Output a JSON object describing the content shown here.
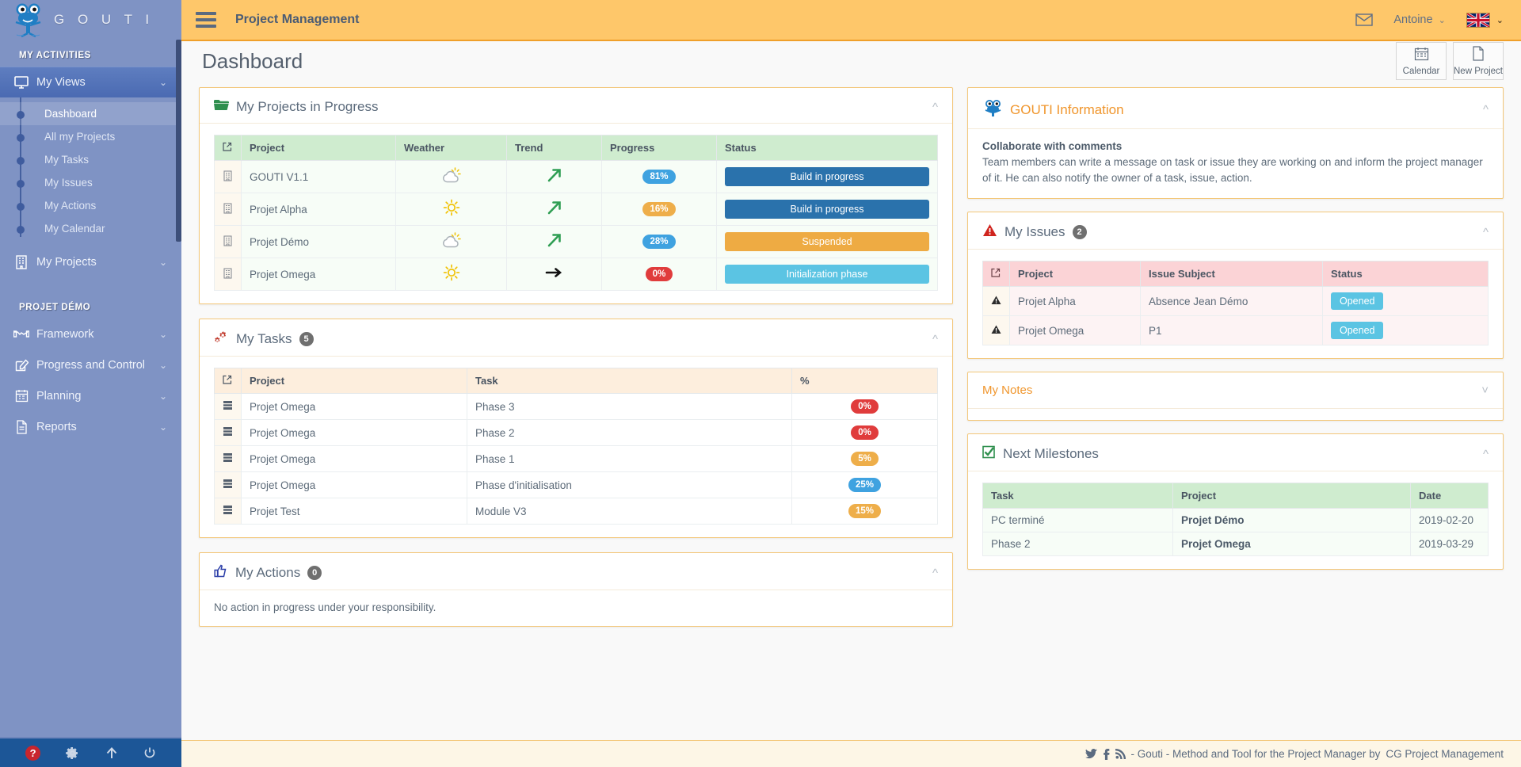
{
  "brand": {
    "name": "G O U T I",
    "logo_icon": "gouti-mascot-icon"
  },
  "sidebar": {
    "section_my_activities": "MY ACTIVITIES",
    "section_project": "PROJET DÉMO",
    "groups": [
      {
        "label": "My Views",
        "icon": "monitor-icon",
        "caret": "⌄",
        "active": true,
        "items": [
          {
            "label": "Dashboard",
            "selected": true
          },
          {
            "label": "All my Projects",
            "selected": false
          },
          {
            "label": "My Tasks",
            "selected": false
          },
          {
            "label": "My Issues",
            "selected": false
          },
          {
            "label": "My Actions",
            "selected": false
          },
          {
            "label": "My Calendar",
            "selected": false
          }
        ]
      },
      {
        "label": "My Projects",
        "icon": "building-icon",
        "caret": "⌄",
        "active": false,
        "items": []
      }
    ],
    "project_groups": [
      {
        "label": "Framework",
        "icon": "handshake-icon",
        "caret": "⌄"
      },
      {
        "label": "Progress and Control",
        "icon": "edit-square-icon",
        "caret": "⌄"
      },
      {
        "label": "Planning",
        "icon": "calendar-icon",
        "caret": "⌄"
      },
      {
        "label": "Reports",
        "icon": "document-icon",
        "caret": "⌄"
      }
    ],
    "footer_icons": [
      "help-icon",
      "gear-icon",
      "arrow-up-icon",
      "power-icon"
    ]
  },
  "topbar": {
    "menu_icon": "hamburger-icon",
    "title": "Project Management",
    "mail_icon": "envelope-icon",
    "user": "Antoine",
    "user_caret": "⌄",
    "flag_icon": "uk-flag-icon",
    "lang_caret": "⌄"
  },
  "page": {
    "title": "Dashboard",
    "actions": [
      {
        "label": "Calendar",
        "icon": "calendar-icon"
      },
      {
        "label": "New Project",
        "icon": "file-icon"
      }
    ]
  },
  "projects_panel": {
    "title": "My Projects in Progress",
    "icon": "open-folder-icon",
    "collapse_icon": "chevron-up-icon",
    "columns": [
      "",
      "Project",
      "Weather",
      "Trend",
      "Progress",
      "Status"
    ],
    "col_icon": "external-link-icon",
    "rows": [
      {
        "row_icon": "project-icon",
        "project": "GOUTI V1.1",
        "weather": "partly-cloudy",
        "trend": "up",
        "progress": "81%",
        "progress_color": "#3fa2e0",
        "status": "Build in progress",
        "status_color": "#2a72ac"
      },
      {
        "row_icon": "project-icon",
        "project": "Projet Alpha",
        "weather": "sunny",
        "trend": "up",
        "progress": "16%",
        "progress_color": "#eeae4a",
        "status": "Build in progress",
        "status_color": "#2a72ac"
      },
      {
        "row_icon": "project-icon",
        "project": "Projet Démo",
        "weather": "partly-cloudy",
        "trend": "up",
        "progress": "28%",
        "progress_color": "#3fa2e0",
        "status": "Suspended",
        "status_color": "#eeab43"
      },
      {
        "row_icon": "project-icon",
        "project": "Projet Omega",
        "weather": "sunny",
        "trend": "flat",
        "progress": "0%",
        "progress_color": "#e03c3c",
        "status": "Initialization phase",
        "status_color": "#5bc4e3"
      }
    ]
  },
  "tasks_panel": {
    "title": "My Tasks",
    "count": "5",
    "icon": "gears-icon",
    "collapse_icon": "chevron-up-icon",
    "columns": [
      "",
      "Project",
      "Task",
      "%"
    ],
    "col_icon": "external-link-icon",
    "rows": [
      {
        "row_icon": "task-icon",
        "project": "Projet Omega",
        "task": "Phase 3",
        "pct": "0%",
        "pct_color": "#e03c3c"
      },
      {
        "row_icon": "task-icon",
        "project": "Projet Omega",
        "task": "Phase 2",
        "pct": "0%",
        "pct_color": "#e03c3c"
      },
      {
        "row_icon": "task-icon",
        "project": "Projet Omega",
        "task": "Phase 1",
        "pct": "5%",
        "pct_color": "#eeae4a"
      },
      {
        "row_icon": "task-icon",
        "project": "Projet Omega",
        "task": "Phase d'initialisation",
        "pct": "25%",
        "pct_color": "#3fa2e0"
      },
      {
        "row_icon": "task-icon",
        "project": "Projet Test",
        "task": "Module V3",
        "pct": "15%",
        "pct_color": "#eeae4a"
      }
    ]
  },
  "actions_panel": {
    "title": "My Actions",
    "count": "0",
    "icon": "thumbs-up-icon",
    "collapse_icon": "chevron-up-icon",
    "empty_text": "No action in progress under your responsibility."
  },
  "info_panel": {
    "title": "GOUTI Information",
    "icon": "gouti-mascot-icon",
    "collapse_icon": "chevron-up-icon",
    "heading": "Collaborate with comments",
    "text": "Team members can write a message on task or issue they are working on and inform the project manager of it. He can also notify the owner of a task, issue, action."
  },
  "issues_panel": {
    "title": "My Issues",
    "count": "2",
    "icon": "warning-triangle-icon",
    "collapse_icon": "chevron-up-icon",
    "columns": [
      "",
      "Project",
      "Issue Subject",
      "Status"
    ],
    "col_icon": "external-link-icon",
    "rows": [
      {
        "row_icon": "warning-icon",
        "project": "Projet Alpha",
        "subject": "Absence Jean Démo",
        "status": "Opened",
        "status_color": "#5bc4e3"
      },
      {
        "row_icon": "warning-icon",
        "project": "Projet Omega",
        "subject": "P1",
        "status": "Opened",
        "status_color": "#5bc4e3"
      }
    ]
  },
  "notes_panel": {
    "title": "My Notes",
    "collapse_icon": "chevron-down-icon"
  },
  "milestones_panel": {
    "title": "Next Milestones",
    "icon": "checkbox-checked-icon",
    "collapse_icon": "chevron-up-icon",
    "columns": [
      "Task",
      "Project",
      "Date"
    ],
    "rows": [
      {
        "task": "PC terminé",
        "project": "Projet Démo",
        "date": "2019-02-20"
      },
      {
        "task": "Phase 2",
        "project": "Projet Omega",
        "date": "2019-03-29"
      }
    ]
  },
  "footer": {
    "icons": [
      "twitter-icon",
      "facebook-icon",
      "rss-icon"
    ],
    "text": "- Gouti - Method and Tool for the Project Manager by",
    "link": "CG Project Management"
  }
}
